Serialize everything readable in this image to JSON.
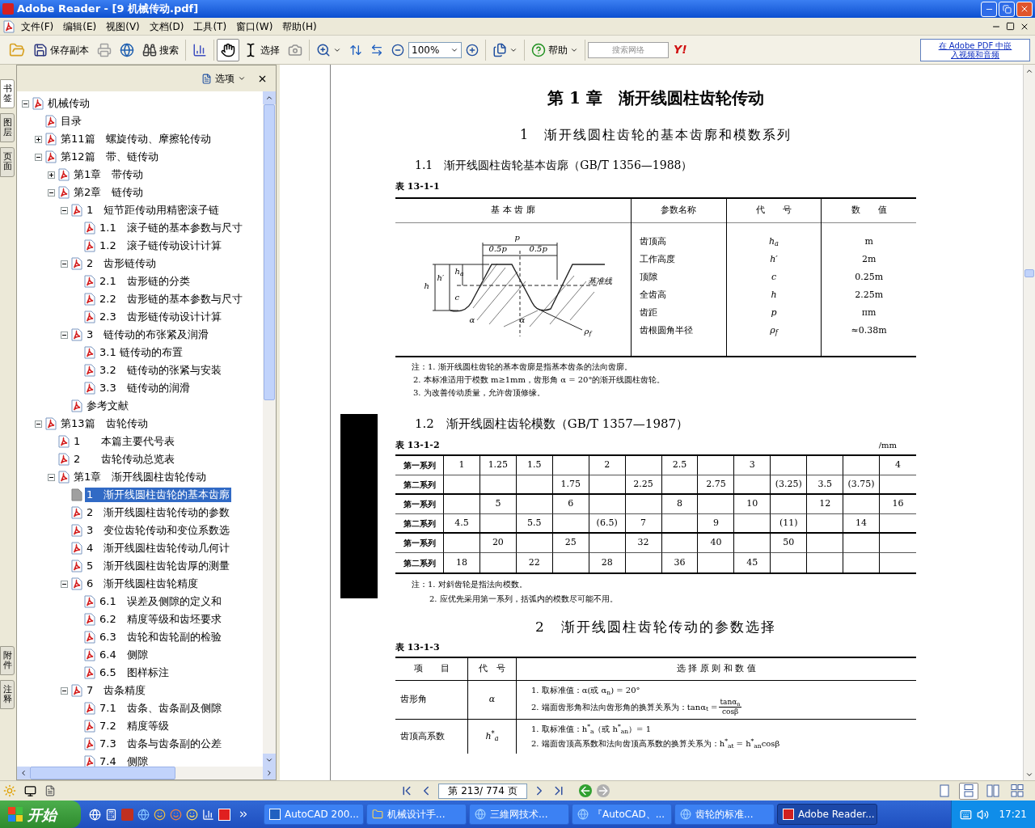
{
  "window": {
    "title": "Adobe Reader - [9 机械传动.pdf]"
  },
  "menu": [
    "文件(F)",
    "编辑(E)",
    "视图(V)",
    "文档(D)",
    "工具(T)",
    "窗口(W)",
    "帮助(H)"
  ],
  "toolbar": {
    "save_copy": "保存副本",
    "search": "搜索",
    "hand_tool": {
      "selected": true
    },
    "select_tool": {
      "label": "选择",
      "selected": false
    },
    "zoom": "100%",
    "help": "帮助",
    "web_search": {
      "placeholder": "搜索网络",
      "logo": "Y!"
    },
    "promo": [
      "在 Adobe PDF 中嵌",
      "入视频和音频"
    ]
  },
  "side_tabs": {
    "top": [
      {
        "label": "书签",
        "selected": true
      },
      {
        "label": "图层",
        "selected": false
      },
      {
        "label": "页面",
        "selected": false
      }
    ],
    "bottom": [
      {
        "label": "附件",
        "selected": false
      },
      {
        "label": "注释",
        "selected": false
      }
    ]
  },
  "bookmarks": {
    "options": "选项",
    "tree": [
      {
        "label": "机械传动",
        "expanded": true,
        "selected": false,
        "children": [
          {
            "label": "目录",
            "selected": false
          },
          {
            "label": "第11篇　螺旋传动、摩擦轮传动",
            "expanded": false,
            "selected": false
          },
          {
            "label": "第12篇　带、链传动",
            "expanded": true,
            "selected": false,
            "children": [
              {
                "label": "第1章　带传动",
                "expanded": false,
                "selected": false
              },
              {
                "label": "第2章　链传动",
                "expanded": true,
                "selected": false,
                "children": [
                  {
                    "label": "1　短节距传动用精密滚子链",
                    "expanded": true,
                    "selected": false,
                    "children": [
                      {
                        "label": "1.1　滚子链的基本参数与尺寸",
                        "selected": false
                      },
                      {
                        "label": "1.2　滚子链传动设计计算",
                        "selected": false
                      }
                    ]
                  },
                  {
                    "label": "2　齿形链传动",
                    "expanded": true,
                    "selected": false,
                    "children": [
                      {
                        "label": "2.1　齿形链的分类",
                        "selected": false
                      },
                      {
                        "label": "2.2　齿形链的基本参数与尺寸",
                        "selected": false
                      },
                      {
                        "label": "2.3　齿形链传动设计计算",
                        "selected": false
                      }
                    ]
                  },
                  {
                    "label": "3　链传动的布张紧及润滑",
                    "expanded": true,
                    "selected": false,
                    "children": [
                      {
                        "label": "3.1 链传动的布置",
                        "selected": false
                      },
                      {
                        "label": "3.2　链传动的张紧与安装",
                        "selected": false
                      },
                      {
                        "label": "3.3　链传动的润滑",
                        "selected": false
                      }
                    ]
                  },
                  {
                    "label": "参考文献",
                    "selected": false
                  }
                ]
              }
            ]
          },
          {
            "label": "第13篇　齿轮传动",
            "expanded": true,
            "selected": false,
            "children": [
              {
                "label": "1　　本篇主要代号表",
                "selected": false
              },
              {
                "label": "2　　齿轮传动总览表",
                "selected": false
              },
              {
                "label": "第1章　渐开线圆柱齿轮传动",
                "expanded": true,
                "selected": false,
                "children": [
                  {
                    "label": "1　渐开线圆柱齿轮的基本齿廓",
                    "selected": true
                  },
                  {
                    "label": "2　渐开线圆柱齿轮传动的参数",
                    "selected": false
                  },
                  {
                    "label": "3　变位齿轮传动和变位系数选",
                    "selected": false
                  },
                  {
                    "label": "4　渐开线圆柱齿轮传动几何计",
                    "selected": false
                  },
                  {
                    "label": "5　渐开线圆柱齿轮齿厚的测量",
                    "selected": false
                  },
                  {
                    "label": "6　渐开线圆柱齿轮精度",
                    "expanded": true,
                    "selected": false,
                    "children": [
                      {
                        "label": "6.1　误差及侧隙的定义和",
                        "selected": false
                      },
                      {
                        "label": "6.2　精度等级和齿坯要求",
                        "selected": false
                      },
                      {
                        "label": "6.3　齿轮和齿轮副的检验",
                        "selected": false
                      },
                      {
                        "label": "6.4　侧隙",
                        "selected": false
                      },
                      {
                        "label": "6.5　图样标注",
                        "selected": false
                      }
                    ]
                  },
                  {
                    "label": "7　齿条精度",
                    "expanded": true,
                    "selected": false,
                    "children": [
                      {
                        "label": "7.1　齿条、齿条副及侧隙",
                        "selected": false
                      },
                      {
                        "label": "7.2　精度等级",
                        "selected": false
                      },
                      {
                        "label": "7.3　齿条与齿条副的公差",
                        "selected": false
                      },
                      {
                        "label": "7.4　侧隙",
                        "selected": false
                      }
                    ]
                  }
                ]
              }
            ]
          }
        ]
      }
    ]
  },
  "document": {
    "chapter_title": "第 1 章　渐开线圆柱齿轮传动",
    "section_1": "1　渐开线圆柱齿轮的基本齿廓和模数系列",
    "subsection_1_1": "1.1　渐开线圆柱齿轮基本齿廓（GB/T 1356—1988）",
    "table_1": {
      "caption": "表 13-1-1",
      "columns": [
        "基 本 齿 廓",
        "参数名称",
        "代　　号",
        "数　　值"
      ],
      "drawing_labels": [
        "p",
        "0.5p",
        "0.5p",
        "基准线",
        "h",
        "h′",
        "h$_{a}$",
        "c",
        "α",
        "α",
        "ρ$_{f}$"
      ],
      "rows": [
        {
          "name": "齿顶高",
          "symbol": "h$_{a}$",
          "value": "m"
        },
        {
          "name": "工作高度",
          "symbol": "h′",
          "value": "2m"
        },
        {
          "name": "顶隙",
          "symbol": "c",
          "value": "0.25m"
        },
        {
          "name": "全齿高",
          "symbol": "h",
          "value": "2.25m"
        },
        {
          "name": "齿距",
          "symbol": "p",
          "value": "πm"
        },
        {
          "name": "齿根圆角半径",
          "symbol": "ρ$_{f}$",
          "value": "≈0.38m"
        }
      ],
      "notes": [
        "注：1. 渐开线圆柱齿轮的基本齿廓是指基本齿条的法向齿廓。",
        "2. 本标准适用于模数 m≥1mm，齿形角 α = 20°的渐开线圆柱齿轮。",
        "3. 为改善传动质量，允许齿顶修缘。"
      ]
    },
    "subsection_1_2": "1.2　渐开线圆柱齿轮模数（GB/T 1357—1987）",
    "table_2": {
      "caption": "表 13-1-2",
      "unit": "/mm",
      "rows": [
        {
          "label": "第一系列",
          "cells": [
            "1",
            "1.25",
            "1.5",
            null,
            "2",
            null,
            "2.5",
            null,
            "3",
            null,
            null,
            null,
            "4"
          ]
        },
        {
          "label": "第二系列",
          "cells": [
            null,
            null,
            null,
            "1.75",
            null,
            "2.25",
            null,
            "2.75",
            null,
            "(3.25)",
            "3.5",
            "(3.75)",
            null
          ]
        },
        {
          "label": "第一系列",
          "cells": [
            null,
            "5",
            null,
            "6",
            null,
            null,
            "8",
            null,
            "10",
            null,
            "12",
            null,
            "16"
          ]
        },
        {
          "label": "第二系列",
          "cells": [
            "4.5",
            null,
            "5.5",
            null,
            "(6.5)",
            "7",
            null,
            "9",
            null,
            "(11)",
            null,
            "14",
            null
          ]
        },
        {
          "label": "第一系列",
          "cells": [
            null,
            "20",
            null,
            "25",
            null,
            "32",
            null,
            "40",
            null,
            "50",
            null,
            null,
            null
          ]
        },
        {
          "label": "第二系列",
          "cells": [
            "18",
            null,
            "22",
            null,
            "28",
            null,
            "36",
            null,
            "45",
            null,
            null,
            null,
            null
          ]
        }
      ],
      "notes": [
        "注：1. 对斜齿轮是指法向模数。",
        "2. 应优先采用第一系列，括弧内的模数尽可能不用。"
      ]
    },
    "section_2": "2　渐开线圆柱齿轮传动的参数选择",
    "table_3": {
      "caption": "表 13-1-3",
      "columns": [
        "项　　目",
        "代　号",
        "选 择 原 则 和 数 值"
      ],
      "rows": [
        {
          "item": "齿形角",
          "symbol": "α",
          "lines": [
            {
              "text": "1. 取标准值：α(或 α$_{n}$) = 20°"
            },
            {
              "text": "2. 端面齿形角和法向齿形角的换算关系为：tanα$_{t}$ =",
              "numerator": "tanα$_{n}$",
              "denominator": "cosβ"
            }
          ]
        },
        {
          "item": "齿顶高系数",
          "symbol": "h$^{*}$$_{a}$",
          "lines": [
            {
              "text": "1. 取标准值：h$^{*}$$_{a}$（或 h$^{*}$$_{an}$）= 1"
            },
            {
              "text": "2. 端面齿顶高系数和法向齿顶高系数的换算关系为：h$^{*}$$_{at}$ = h$^{*}$$_{an}$cosβ"
            }
          ]
        }
      ]
    }
  },
  "status_bar": {
    "page": "第 213/ 774 页",
    "layouts": [
      {
        "kind": "single",
        "selected": false
      },
      {
        "kind": "continuous",
        "selected": true
      },
      {
        "kind": "facing",
        "selected": false
      },
      {
        "kind": "continuous_facing",
        "selected": false
      }
    ]
  },
  "taskbar": {
    "start": "开始",
    "tasks": [
      {
        "label": "AutoCAD 200...",
        "kind": "autocad",
        "selected": false
      },
      {
        "label": "机械设计手...",
        "kind": "folder",
        "selected": false
      },
      {
        "label": "三維网技术...",
        "kind": "browser",
        "selected": false
      },
      {
        "label": "『AutoCAD、...",
        "kind": "browser",
        "selected": false
      },
      {
        "label": "齿轮的标准...",
        "kind": "browser",
        "selected": false
      },
      {
        "label": "Adobe Reader...",
        "kind": "reader",
        "selected": true
      }
    ],
    "clock": "17:21"
  }
}
